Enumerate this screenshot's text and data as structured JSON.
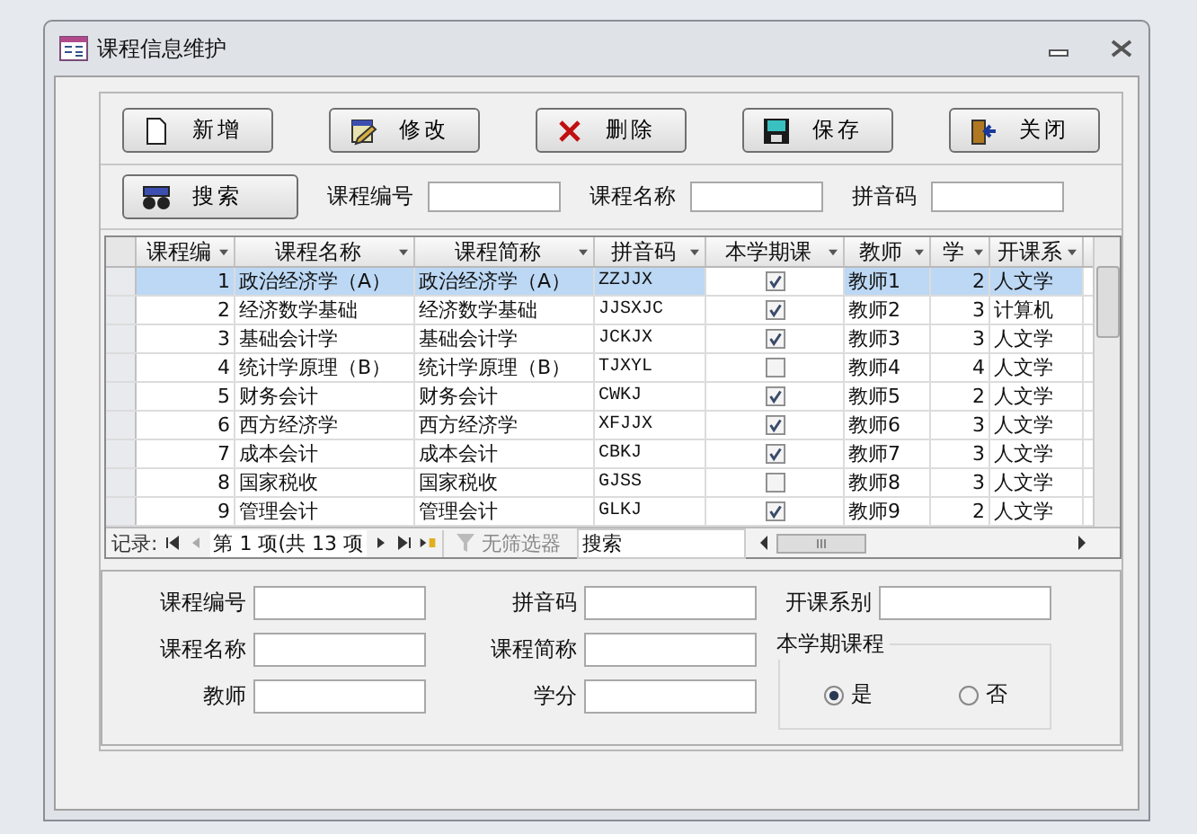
{
  "window": {
    "title": "课程信息维护"
  },
  "toolbar": [
    {
      "kind": "new",
      "label": "新增"
    },
    {
      "kind": "edit",
      "label": "修改"
    },
    {
      "kind": "delete",
      "label": "删除"
    },
    {
      "kind": "save",
      "label": "保存"
    },
    {
      "kind": "close",
      "label": "关闭"
    }
  ],
  "search": {
    "button": "搜索",
    "fields": [
      {
        "label": "课程编号"
      },
      {
        "label": "课程名称"
      },
      {
        "label": "拼音码"
      }
    ]
  },
  "table": {
    "columns": [
      "课程编",
      "课程名称",
      "课程简称",
      "拼音码",
      "本学期课",
      "教师",
      "学",
      "开课系"
    ],
    "rows": [
      {
        "id": "1",
        "name": "政治经济学（A）",
        "short": "政治经济学（A）",
        "pinyin": "ZZJJX",
        "current_term": true,
        "teacher": "教师1",
        "credit": "2",
        "dept": "人文学",
        "selected": true
      },
      {
        "id": "2",
        "name": "经济数学基础",
        "short": "经济数学基础",
        "pinyin": "JJSXJC",
        "current_term": true,
        "teacher": "教师2",
        "credit": "3",
        "dept": "计算机",
        "selected": false
      },
      {
        "id": "3",
        "name": "基础会计学",
        "short": "基础会计学",
        "pinyin": "JCKJX",
        "current_term": true,
        "teacher": "教师3",
        "credit": "3",
        "dept": "人文学",
        "selected": false
      },
      {
        "id": "4",
        "name": "统计学原理（B）",
        "short": "统计学原理（B）",
        "pinyin": "TJXYL",
        "current_term": false,
        "teacher": "教师4",
        "credit": "4",
        "dept": "人文学",
        "selected": false
      },
      {
        "id": "5",
        "name": "财务会计",
        "short": "财务会计",
        "pinyin": "CWKJ",
        "current_term": true,
        "teacher": "教师5",
        "credit": "2",
        "dept": "人文学",
        "selected": false
      },
      {
        "id": "6",
        "name": "西方经济学",
        "short": "西方经济学",
        "pinyin": "XFJJX",
        "current_term": true,
        "teacher": "教师6",
        "credit": "3",
        "dept": "人文学",
        "selected": false
      },
      {
        "id": "7",
        "name": "成本会计",
        "short": "成本会计",
        "pinyin": "CBKJ",
        "current_term": true,
        "teacher": "教师7",
        "credit": "3",
        "dept": "人文学",
        "selected": false
      },
      {
        "id": "8",
        "name": "国家税收",
        "short": "国家税收",
        "pinyin": "GJSS",
        "current_term": false,
        "teacher": "教师8",
        "credit": "3",
        "dept": "人文学",
        "selected": false
      },
      {
        "id": "9",
        "name": "管理会计",
        "short": "管理会计",
        "pinyin": "GLKJ",
        "current_term": true,
        "teacher": "教师9",
        "credit": "2",
        "dept": "人文学",
        "selected": false
      }
    ]
  },
  "record_nav": {
    "label": "记录:",
    "position": "第 1 项(共 13 项",
    "filter": "无筛选器",
    "search": "搜索"
  },
  "detail": {
    "columns": [
      [
        {
          "label": "课程编号"
        },
        {
          "label": "课程名称"
        },
        {
          "label": "教师"
        }
      ],
      [
        {
          "label": "拼音码"
        },
        {
          "label": "课程简称"
        },
        {
          "label": "学分"
        }
      ],
      [
        {
          "label": "开课系别"
        }
      ]
    ],
    "term_group": {
      "label": "本学期课程",
      "options": [
        {
          "label": "是",
          "selected": true
        },
        {
          "label": "否",
          "selected": false
        }
      ]
    }
  }
}
